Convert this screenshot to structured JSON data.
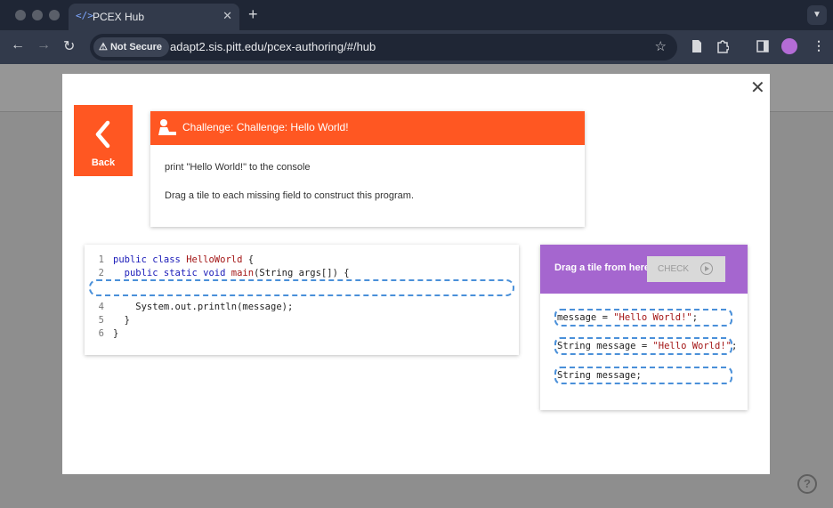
{
  "browser": {
    "tab_title": "PCEX Hub",
    "tab_icon": "code-icon",
    "security_label": "Not Secure",
    "url": "adapt2.sis.pitt.edu/pcex-authoring/#/hub"
  },
  "modal": {
    "back_label": "Back",
    "challenge": {
      "title": "Challenge: Challenge: Hello World!",
      "description": "print \"Hello World!\" to the console",
      "instruction": "Drag a tile to each missing field to construct this program."
    },
    "code_lines": [
      {
        "num": "1",
        "k1": "public class ",
        "c1": "HelloWorld",
        "p1": " {"
      },
      {
        "num": "2",
        "k1": "  public static void ",
        "c1": "main",
        "p1": "(String args[]) {"
      },
      {
        "num": "4",
        "p1": "    System.out.println(message);"
      },
      {
        "num": "5",
        "p1": "  }"
      },
      {
        "num": "6",
        "p1": "}"
      }
    ],
    "tiles_panel": {
      "header": "Drag a tile from here",
      "check_label": "CHECK",
      "tiles": [
        {
          "code": "message = ",
          "str": "\"Hello World!\"",
          "end": ";"
        },
        {
          "code": "String message = ",
          "str": "\"Hello World!\"",
          "end": ";"
        },
        {
          "code": "String message;",
          "str": "",
          "end": ""
        }
      ]
    }
  },
  "colors": {
    "accent_orange": "#ff5722",
    "accent_purple": "#a566cf",
    "blank_border": "#4a90d9"
  }
}
